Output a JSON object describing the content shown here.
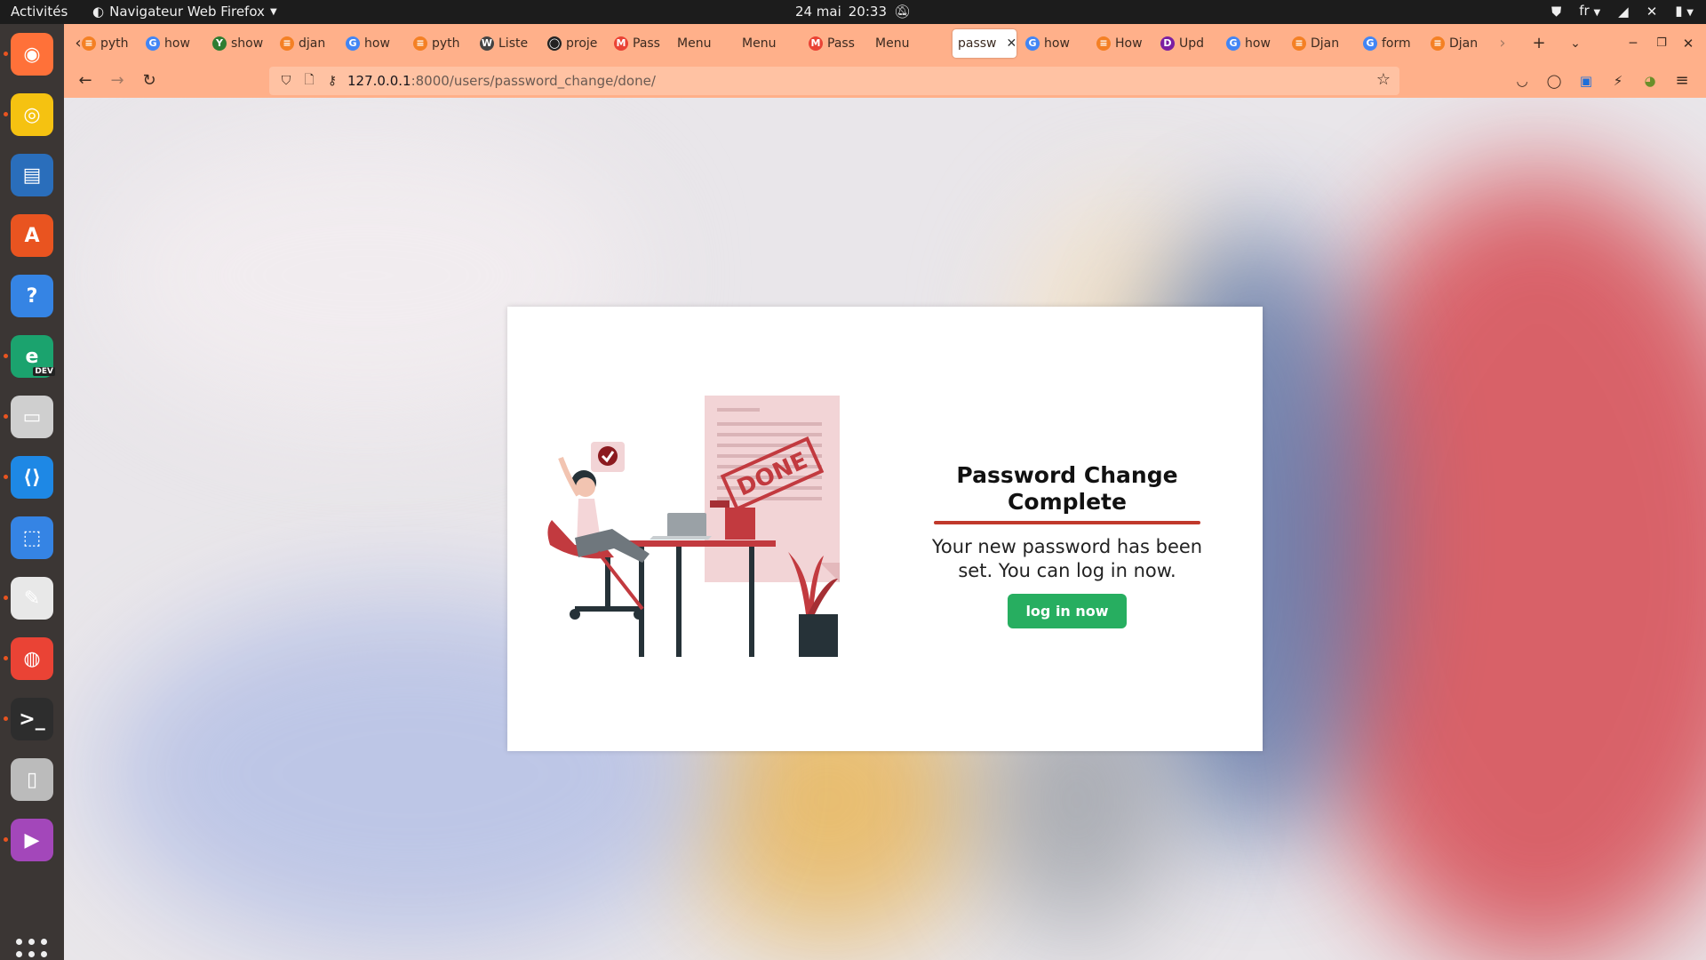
{
  "topbar": {
    "activities": "Activités",
    "app_name": "Navigateur Web Firefox",
    "date": "24 mai",
    "time": "20:33",
    "language": "fr"
  },
  "dock": {
    "apps": [
      {
        "name": "firefox-icon",
        "color": "#ff7139",
        "running": true
      },
      {
        "name": "rhythmbox-icon",
        "color": "#f5c211",
        "running": true
      },
      {
        "name": "writer-icon",
        "color": "#2a6ebb",
        "running": false
      },
      {
        "name": "software-center-icon",
        "color": "#e95420",
        "running": false
      },
      {
        "name": "help-icon",
        "color": "#3584e4",
        "running": false
      },
      {
        "name": "edge-dev-icon",
        "color": "#1ba36e",
        "running": true,
        "badge": "DEV"
      },
      {
        "name": "files-icon",
        "color": "#cfcfcf",
        "running": true
      },
      {
        "name": "vscode-icon",
        "color": "#1e88e5",
        "running": true
      },
      {
        "name": "screenshot-icon",
        "color": "#3584e4",
        "running": false
      },
      {
        "name": "text-editor-icon",
        "color": "#e8e8e8",
        "running": true
      },
      {
        "name": "chrome-icon",
        "color": "#ea4335",
        "running": true
      },
      {
        "name": "terminal-icon",
        "color": "#2d2d2d",
        "running": true
      },
      {
        "name": "archive-icon",
        "color": "#bbbbbb",
        "running": false
      },
      {
        "name": "video-player-icon",
        "color": "#a347ba",
        "running": true
      }
    ]
  },
  "browser": {
    "tabs": [
      {
        "label": "pyth",
        "icon": "stackoverflow"
      },
      {
        "label": "how",
        "icon": "google"
      },
      {
        "label": "show",
        "icon": "hackernoon"
      },
      {
        "label": "djan",
        "icon": "stackoverflow"
      },
      {
        "label": "how",
        "icon": "google"
      },
      {
        "label": "pyth",
        "icon": "stackoverflow"
      },
      {
        "label": "Liste",
        "icon": "wikipedia"
      },
      {
        "label": "proje",
        "icon": "github"
      },
      {
        "label": "Pass",
        "icon": "gmail"
      },
      {
        "label": "Menu",
        "icon": "none"
      },
      {
        "label": "Menu",
        "icon": "none"
      },
      {
        "label": "Pass",
        "icon": "gmail"
      },
      {
        "label": "Menu",
        "icon": "none"
      },
      {
        "label": "passw",
        "icon": "none",
        "active": true
      },
      {
        "label": "how",
        "icon": "google"
      },
      {
        "label": "How",
        "icon": "stackoverflow"
      },
      {
        "label": "Upd",
        "icon": "purple"
      },
      {
        "label": "how",
        "icon": "google"
      },
      {
        "label": "Djan",
        "icon": "stackoverflow"
      },
      {
        "label": "form",
        "icon": "google"
      },
      {
        "label": "Djan",
        "icon": "stackoverflow"
      }
    ],
    "url_host": "127.0.0.1",
    "url_path": ":8000/users/password_change/done/"
  },
  "page": {
    "title": "Password Change Complete",
    "message": "Your new password has been set. You can log in now.",
    "button_label": "log in now",
    "illustration_stamp": "DONE",
    "accent_color": "#c0392b",
    "button_color": "#27ae60"
  }
}
